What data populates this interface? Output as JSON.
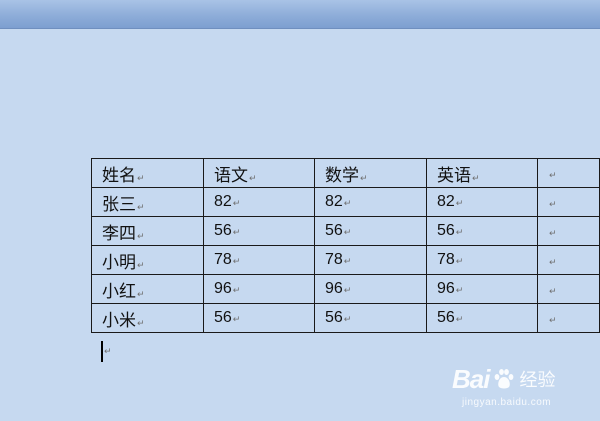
{
  "table": {
    "header": [
      "姓名",
      "语文",
      "数学",
      "英语",
      ""
    ],
    "rows": [
      [
        "张三",
        "82",
        "82",
        "82",
        ""
      ],
      [
        "李四",
        "56",
        "56",
        "56",
        ""
      ],
      [
        "小明",
        "78",
        "78",
        "78",
        ""
      ],
      [
        "小红",
        "96",
        "96",
        "96",
        ""
      ],
      [
        "小米",
        "56",
        "56",
        "56",
        ""
      ]
    ]
  },
  "marks": {
    "paragraph": "↵"
  },
  "watermark": {
    "brand": "Bai",
    "brand_suffix": "经验",
    "url": "jingyan.baidu.com"
  },
  "colors": {
    "page_background": "#c6d9f0",
    "grid_border": "#1a1a1a"
  }
}
